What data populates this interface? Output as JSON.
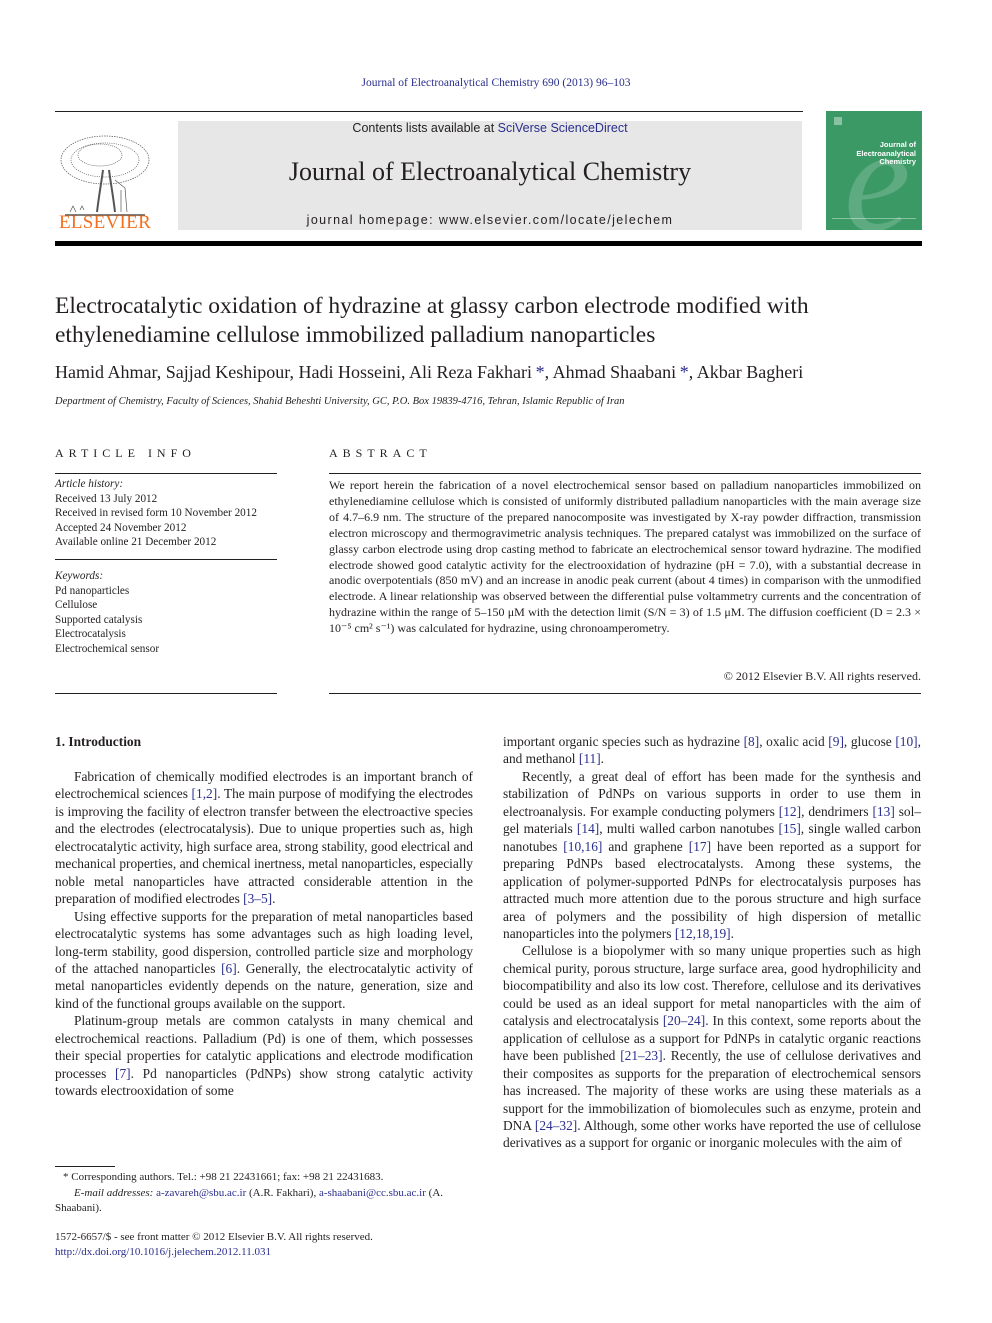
{
  "header": {
    "running_head": "Journal of Electroanalytical Chemistry 690 (2013) 96–103",
    "contents_prefix": "Contents lists available at ",
    "contents_link": "SciVerse ScienceDirect",
    "journal_title": "Journal of Electroanalytical Chemistry",
    "homepage_prefix": "journal homepage: ",
    "homepage_url": "www.elsevier.com/locate/jelechem",
    "publisher_logo_text": "ELSEVIER",
    "cover": {
      "line1": "Journal of",
      "line2": "Electroanalytical",
      "line3": "Chemistry"
    }
  },
  "article": {
    "title": "Electrocatalytic oxidation of hydrazine at glassy carbon electrode modified with ethylenediamine cellulose immobilized palladium nanoparticles",
    "authors": [
      {
        "name": "Hamid Ahmar",
        "corresponding": false
      },
      {
        "name": "Sajjad Keshipour",
        "corresponding": false
      },
      {
        "name": "Hadi Hosseini",
        "corresponding": false
      },
      {
        "name": "Ali Reza Fakhari",
        "corresponding": true
      },
      {
        "name": "Ahmad Shaabani",
        "corresponding": true
      },
      {
        "name": "Akbar Bagheri",
        "corresponding": false
      }
    ],
    "affiliation": "Department of Chemistry, Faculty of Sciences, Shahid Beheshti University, GC, P.O. Box 19839-4716, Tehran, Islamic Republic of Iran"
  },
  "article_info": {
    "heading": "ARTICLE INFO",
    "history_label": "Article history:",
    "history": [
      "Received 13 July 2012",
      "Received in revised form 10 November 2012",
      "Accepted 24 November 2012",
      "Available online 21 December 2012"
    ],
    "keywords_label": "Keywords:",
    "keywords": [
      "Pd nanoparticles",
      "Cellulose",
      "Supported catalysis",
      "Electrocatalysis",
      "Electrochemical sensor"
    ]
  },
  "abstract": {
    "heading": "ABSTRACT",
    "text": "We report herein the fabrication of a novel electrochemical sensor based on palladium nanoparticles immobilized on ethylenediamine cellulose which is consisted of uniformly distributed palladium nanoparticles with the main average size of 4.7–6.9 nm. The structure of the prepared nanocomposite was investigated by X-ray powder diffraction, transmission electron microscopy and thermogravimetric analysis techniques. The prepared catalyst was immobilized on the surface of glassy carbon electrode using drop casting method to fabricate an electrochemical sensor toward hydrazine. The modified electrode showed good catalytic activity for the electrooxidation of hydrazine (pH = 7.0), with a substantial decrease in anodic overpotentials (850 mV) and an increase in anodic peak current (about 4 times) in comparison with the unmodified electrode. A linear relationship was observed between the differential pulse voltammetry currents and the concentration of hydrazine within the range of 5–150 μM with the detection limit (S/N = 3) of 1.5 μM. The diffusion coefficient (D = 2.3 × 10⁻⁵ cm² s⁻¹) was calculated for hydrazine, using chronoamperometry.",
    "copyright": "© 2012 Elsevier B.V. All rights reserved."
  },
  "introduction": {
    "heading": "1. Introduction",
    "left_paragraphs": [
      "Fabrication of chemically modified electrodes is an important branch of electrochemical sciences [1,2]. The main purpose of modifying the electrodes is improving the facility of electron transfer between the electroactive species and the electrodes (electrocatalysis). Due to unique properties such as, high electrocatalytic activity, high surface area, strong stability, good electrical and mechanical properties, and chemical inertness, metal nanoparticles, especially noble metal nanoparticles have attracted considerable attention in the preparation of modified electrodes [3–5].",
      "Using effective supports for the preparation of metal nanoparticles based electrocatalytic systems has some advantages such as high loading level, long-term stability, good dispersion, controlled particle size and morphology of the attached nanoparticles [6]. Generally, the electrocatalytic activity of metal nanoparticles evidently depends on the nature, generation, size and kind of the functional groups available on the support.",
      "Platinum-group metals are common catalysts in many chemical and electrochemical reactions. Palladium (Pd) is one of them, which possesses their special properties for catalytic applications and electrode modification processes [7]. Pd nanoparticles (PdNPs) show strong catalytic activity towards electrooxidation of some"
    ],
    "right_paragraphs": [
      "important organic species such as hydrazine [8], oxalic acid [9], glucose [10], and methanol [11].",
      "Recently, a great deal of effort has been made for the synthesis and stabilization of PdNPs on various supports in order to use them in electroanalysis. For example conducting polymers [12], dendrimers [13] sol–gel materials [14], multi walled carbon nanotubes [15], single walled carbon nanotubes [10,16] and graphene [17] have been reported as a support for preparing PdNPs based electrocatalysts. Among these systems, the application of polymer-supported PdNPs for electrocatalysis purposes has attracted much more attention due to the porous structure and high surface area of polymers and the possibility of high dispersion of metallic nanoparticles into the polymers [12,18,19].",
      "Cellulose is a biopolymer with so many unique properties such as high chemical purity, porous structure, large surface area, good hydrophilicity and biocompatibility and also its low cost. Therefore, cellulose and its derivatives could be used as an ideal support for metal nanoparticles with the aim of catalysis and electrocatalysis [20–24]. In this context, some reports about the application of cellulose as a support for PdNPs in catalytic organic reactions have been published [21–23]. Recently, the use of cellulose derivatives and their composites as supports for the preparation of electrochemical sensors has increased. The majority of these works are using these materials as a support for the immobilization of biomolecules such as enzyme, protein and DNA [24–32]. Although, some other works have reported the use of cellulose derivatives as a support for organic or inorganic molecules with the aim of"
    ]
  },
  "footnotes": {
    "corresponding": "* Corresponding authors. Tel.: +98 21 22431661; fax: +98 21 22431683.",
    "email_label": "E-mail addresses:",
    "email1": "a-zavareh@sbu.ac.ir",
    "email1_owner": " (A.R. Fakhari), ",
    "email2": "a-shaabani@cc.sbu.ac.ir",
    "email2_owner": " (A. Shaabani).",
    "issn": "1572-6657/$ - see front matter © 2012 Elsevier B.V. All rights reserved.",
    "doi": "http://dx.doi.org/10.1016/j.jelechem.2012.11.031"
  },
  "colors": {
    "link": "#2a2e8c",
    "elsevier_orange": "#f37021",
    "cover_green": "#3b9966",
    "masthead_gray": "#e7e7e7"
  }
}
